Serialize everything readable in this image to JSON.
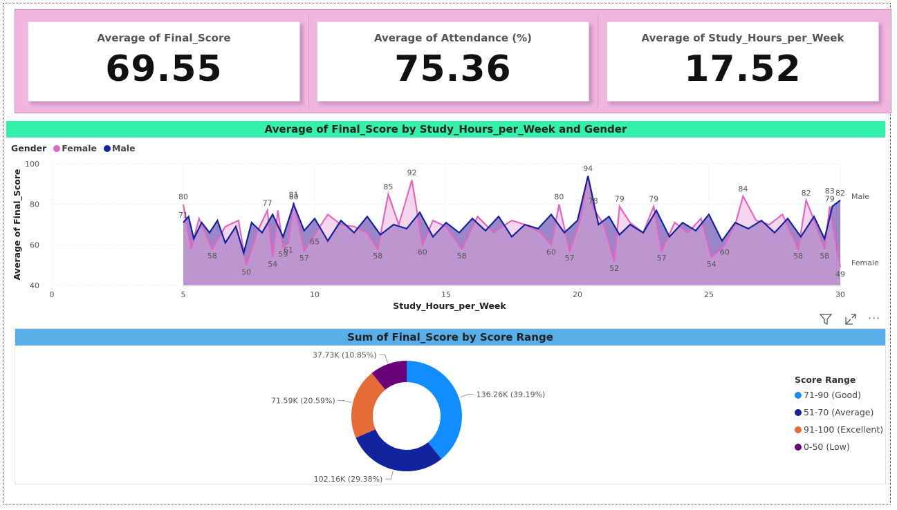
{
  "kpis": [
    {
      "title": "Average of Final_Score",
      "value": "69.55"
    },
    {
      "title": "Average of Attendance (%)",
      "value": "75.36"
    },
    {
      "title": "Average of Study_Hours_per_Week",
      "value": "17.52"
    }
  ],
  "line_chart": {
    "title": "Average of Final_Score by Study_Hours_per_Week and Gender",
    "legend_title": "Gender",
    "legend": [
      {
        "name": "Female",
        "color": "#e265c2"
      },
      {
        "name": "Male",
        "color": "#12239e"
      }
    ],
    "end_labels": {
      "male": "Male",
      "female": "Female"
    }
  },
  "donut_chart": {
    "title": "Sum of Final_Score by Score Range",
    "legend_title": "Score Range"
  },
  "toolbar": {
    "filter_icon": "filter-icon",
    "focus_icon": "focus-mode-icon",
    "more_icon": "more-options-icon"
  },
  "chart_data": [
    {
      "type": "area",
      "title": "Average of Final_Score by Study_Hours_per_Week and Gender",
      "xlabel": "Study_Hours_per_Week",
      "ylabel": "Average of Final_Score",
      "xlim": [
        0,
        30
      ],
      "ylim": [
        40,
        100
      ],
      "x_ticks": [
        0,
        5,
        10,
        15,
        20,
        25,
        30
      ],
      "y_ticks": [
        40,
        60,
        80,
        100
      ],
      "legend_placement": "top-left",
      "series": [
        {
          "name": "Female",
          "color": "#e265c2",
          "points": [
            [
              5,
              80
            ],
            [
              5.3,
              58
            ],
            [
              5.6,
              73
            ],
            [
              6.1,
              58
            ],
            [
              6.6,
              69
            ],
            [
              7.1,
              72
            ],
            [
              7.4,
              50
            ],
            [
              7.8,
              66
            ],
            [
              8.2,
              77
            ],
            [
              8.4,
              54
            ],
            [
              8.6,
              77
            ],
            [
              8.8,
              59
            ],
            [
              9,
              61
            ],
            [
              9.2,
              81
            ],
            [
              9.6,
              57
            ],
            [
              10,
              65
            ],
            [
              10.5,
              75
            ],
            [
              11,
              70
            ],
            [
              11.5,
              69
            ],
            [
              12,
              66
            ],
            [
              12.4,
              58
            ],
            [
              12.8,
              85
            ],
            [
              13.2,
              70
            ],
            [
              13.7,
              92
            ],
            [
              14.1,
              60
            ],
            [
              14.5,
              72
            ],
            [
              15,
              69
            ],
            [
              15.6,
              58
            ],
            [
              16.2,
              74
            ],
            [
              16.8,
              66
            ],
            [
              17.5,
              72
            ],
            [
              18,
              70
            ],
            [
              18.6,
              66
            ],
            [
              19,
              60
            ],
            [
              19.3,
              80
            ],
            [
              19.7,
              57
            ],
            [
              20.1,
              72
            ],
            [
              20.4,
              94
            ],
            [
              20.6,
              78
            ],
            [
              21,
              70
            ],
            [
              21.4,
              52
            ],
            [
              21.6,
              79
            ],
            [
              22,
              71
            ],
            [
              22.5,
              66
            ],
            [
              22.9,
              79
            ],
            [
              23.2,
              57
            ],
            [
              23.7,
              71
            ],
            [
              24.2,
              66
            ],
            [
              24.7,
              73
            ],
            [
              25.1,
              54
            ],
            [
              25.6,
              60
            ],
            [
              26,
              70
            ],
            [
              26.3,
              84
            ],
            [
              26.8,
              72
            ],
            [
              27.3,
              70
            ],
            [
              27.8,
              75
            ],
            [
              28.4,
              58
            ],
            [
              28.7,
              82
            ],
            [
              29.1,
              69
            ],
            [
              29.4,
              58
            ],
            [
              29.6,
              79
            ],
            [
              29.8,
              63
            ],
            [
              30,
              49
            ]
          ]
        },
        {
          "name": "Male",
          "color": "#12239e",
          "points": [
            [
              5,
              71
            ],
            [
              5.2,
              74
            ],
            [
              5.4,
              63
            ],
            [
              5.7,
              71
            ],
            [
              6,
              66
            ],
            [
              6.3,
              72
            ],
            [
              6.6,
              61
            ],
            [
              7,
              69
            ],
            [
              7.3,
              56
            ],
            [
              7.6,
              71
            ],
            [
              8,
              66
            ],
            [
              8.4,
              75
            ],
            [
              8.8,
              64
            ],
            [
              9.2,
              80
            ],
            [
              9.6,
              67
            ],
            [
              10,
              73
            ],
            [
              10.5,
              62
            ],
            [
              11,
              72
            ],
            [
              11.5,
              66
            ],
            [
              12,
              74
            ],
            [
              12.5,
              65
            ],
            [
              13,
              70
            ],
            [
              13.5,
              68
            ],
            [
              14,
              76
            ],
            [
              14.5,
              64
            ],
            [
              15,
              71
            ],
            [
              15.5,
              66
            ],
            [
              16,
              73
            ],
            [
              16.5,
              67
            ],
            [
              17,
              74
            ],
            [
              17.5,
              64
            ],
            [
              18,
              70
            ],
            [
              18.5,
              68
            ],
            [
              19,
              75
            ],
            [
              19.5,
              66
            ],
            [
              20,
              72
            ],
            [
              20.4,
              94
            ],
            [
              20.8,
              70
            ],
            [
              21.2,
              74
            ],
            [
              21.6,
              65
            ],
            [
              22,
              70
            ],
            [
              22.5,
              66
            ],
            [
              23,
              77
            ],
            [
              23.5,
              64
            ],
            [
              24,
              71
            ],
            [
              24.5,
              67
            ],
            [
              25,
              75
            ],
            [
              25.5,
              62
            ],
            [
              26,
              71
            ],
            [
              26.5,
              68
            ],
            [
              27,
              72
            ],
            [
              27.5,
              66
            ],
            [
              28,
              73
            ],
            [
              28.5,
              64
            ],
            [
              29,
              74
            ],
            [
              29.4,
              63
            ],
            [
              29.7,
              79
            ],
            [
              30,
              82
            ]
          ]
        }
      ],
      "data_labels": [
        {
          "x": 5,
          "y": 80,
          "text": "80"
        },
        {
          "x": 5,
          "y": 71,
          "text": "71"
        },
        {
          "x": 6.1,
          "y": 58,
          "text": "58"
        },
        {
          "x": 7.4,
          "y": 50,
          "text": "50"
        },
        {
          "x": 8.2,
          "y": 77,
          "text": "77"
        },
        {
          "x": 8.4,
          "y": 54,
          "text": "54"
        },
        {
          "x": 8.8,
          "y": 59,
          "text": "59"
        },
        {
          "x": 9,
          "y": 61,
          "text": "61"
        },
        {
          "x": 9.2,
          "y": 81,
          "text": "81"
        },
        {
          "x": 9.2,
          "y": 80,
          "text": "80"
        },
        {
          "x": 9.6,
          "y": 57,
          "text": "57"
        },
        {
          "x": 10,
          "y": 65,
          "text": "65"
        },
        {
          "x": 12.4,
          "y": 58,
          "text": "58"
        },
        {
          "x": 12.8,
          "y": 85,
          "text": "85"
        },
        {
          "x": 13.7,
          "y": 92,
          "text": "92"
        },
        {
          "x": 14.1,
          "y": 60,
          "text": "60"
        },
        {
          "x": 15.6,
          "y": 58,
          "text": "58"
        },
        {
          "x": 19,
          "y": 60,
          "text": "60"
        },
        {
          "x": 19.3,
          "y": 80,
          "text": "80"
        },
        {
          "x": 19.7,
          "y": 57,
          "text": "57"
        },
        {
          "x": 20.4,
          "y": 94,
          "text": "94"
        },
        {
          "x": 20.6,
          "y": 78,
          "text": "78"
        },
        {
          "x": 21.4,
          "y": 52,
          "text": "52"
        },
        {
          "x": 21.6,
          "y": 79,
          "text": "79"
        },
        {
          "x": 22.9,
          "y": 79,
          "text": "79"
        },
        {
          "x": 23.2,
          "y": 57,
          "text": "57"
        },
        {
          "x": 25.1,
          "y": 54,
          "text": "54"
        },
        {
          "x": 25.6,
          "y": 60,
          "text": "60"
        },
        {
          "x": 26.3,
          "y": 84,
          "text": "84"
        },
        {
          "x": 28.4,
          "y": 58,
          "text": "58"
        },
        {
          "x": 28.7,
          "y": 82,
          "text": "82"
        },
        {
          "x": 29.4,
          "y": 58,
          "text": "58"
        },
        {
          "x": 29.6,
          "y": 79,
          "text": "79"
        },
        {
          "x": 29.6,
          "y": 83,
          "text": "83"
        },
        {
          "x": 30,
          "y": 82,
          "text": "82"
        },
        {
          "x": 30,
          "y": 49,
          "text": "49"
        }
      ],
      "area_fill_color": "#9a87c8"
    },
    {
      "type": "pie",
      "title": "Sum of Final_Score by Score Range",
      "hole": true,
      "legend_title": "Score Range",
      "legend_placement": "right",
      "slices": [
        {
          "name": "71-90 (Good)",
          "value": 136.26,
          "percent": 39.19,
          "label": "136.26K (39.19%)",
          "color": "#118dff"
        },
        {
          "name": "51-70 (Average)",
          "value": 102.16,
          "percent": 29.38,
          "label": "102.16K (29.38%)",
          "color": "#12239e"
        },
        {
          "name": "91-100 (Excellent)",
          "value": 71.59,
          "percent": 20.59,
          "label": "71.59K (20.59%)",
          "color": "#e66c37"
        },
        {
          "name": "0-50 (Low)",
          "value": 37.73,
          "percent": 10.85,
          "label": "37.73K (10.85%)",
          "color": "#6b007b"
        }
      ]
    }
  ]
}
